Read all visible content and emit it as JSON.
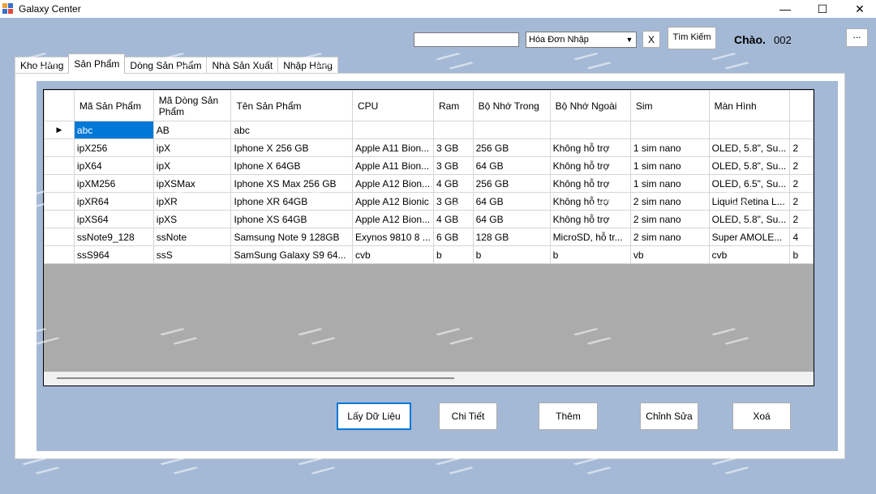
{
  "window": {
    "title": "Galaxy Center",
    "minimize": "—",
    "maximize": "☐",
    "close": "✕"
  },
  "topbar": {
    "search_value": "",
    "combo_value": "Hóa Đơn Nhập",
    "clear_label": "X",
    "search_label": "Tìm Kiếm",
    "greeting": "Chào.",
    "user_code": "002",
    "more_label": "..."
  },
  "tabs": [
    "Kho Hàng",
    "Sản Phẩm",
    "Dòng Sản Phẩm",
    "Nhà Sản Xuất",
    "Nhập Hàng"
  ],
  "table": {
    "headers": [
      "Mã Sản Phẩm",
      "Mã Dòng Sản Phẩm",
      "Tên Sản Phẩm",
      "CPU",
      "Ram",
      "Bộ Nhớ Trong",
      "Bộ Nhớ Ngoài",
      "Sim",
      "Màn Hình",
      ""
    ],
    "rows": [
      [
        "abc",
        "AB",
        "abc",
        "",
        "",
        "",
        "",
        "",
        "",
        ""
      ],
      [
        "ipX256",
        "ipX",
        "Iphone X 256 GB",
        "Apple A11 Bion...",
        "3 GB",
        "256 GB",
        "Không hỗ trợ",
        "1 sim nano",
        "OLED, 5.8\", Su...",
        "2"
      ],
      [
        "ipX64",
        "ipX",
        "Iphone X 64GB",
        "Apple A11 Bion...",
        "3 GB",
        "64 GB",
        "Không hỗ trợ",
        "1 sim nano",
        "OLED, 5.8\", Su...",
        "2"
      ],
      [
        "ipXM256",
        "ipXSMax",
        "Iphone XS Max 256 GB",
        "Apple A12 Bion...",
        "4 GB",
        "256 GB",
        "Không hỗ trợ",
        "1 sim nano",
        "OLED, 6.5\", Su...",
        "2"
      ],
      [
        "ipXR64",
        "ipXR",
        "Iphone XR 64GB",
        "Apple A12 Bionic",
        "3 GB",
        "64 GB",
        "Không hỗ trợ",
        "2 sim nano",
        "Liquid Retina L...",
        "2"
      ],
      [
        "ipXS64",
        "ipXS",
        "Iphone XS 64GB",
        "Apple A12 Bion...",
        "4 GB",
        "64 GB",
        "Không hỗ trợ",
        "2 sim nano",
        "OLED, 5.8\", Su...",
        "2"
      ],
      [
        "ssNote9_128",
        "ssNote",
        "Samsung Note 9 128GB",
        "Exynos 9810 8 ...",
        "6 GB",
        "128 GB",
        "MicroSD, hỗ tr...",
        "2 sim nano",
        "Super AMOLE...",
        "4"
      ],
      [
        "ssS964",
        "ssS",
        "SamSung Galaxy S9 64...",
        "cvb",
        "b",
        "b",
        "b",
        "vb",
        "cvb",
        "b"
      ]
    ]
  },
  "actions": {
    "fetch": "Lấy Dữ Liệu",
    "detail": "Chi Tiết",
    "add": "Thêm",
    "edit": "Chỉnh Sửa",
    "delete": "Xoá"
  },
  "colors": {
    "background": "#a4b9d6",
    "selection": "#0078d7"
  }
}
